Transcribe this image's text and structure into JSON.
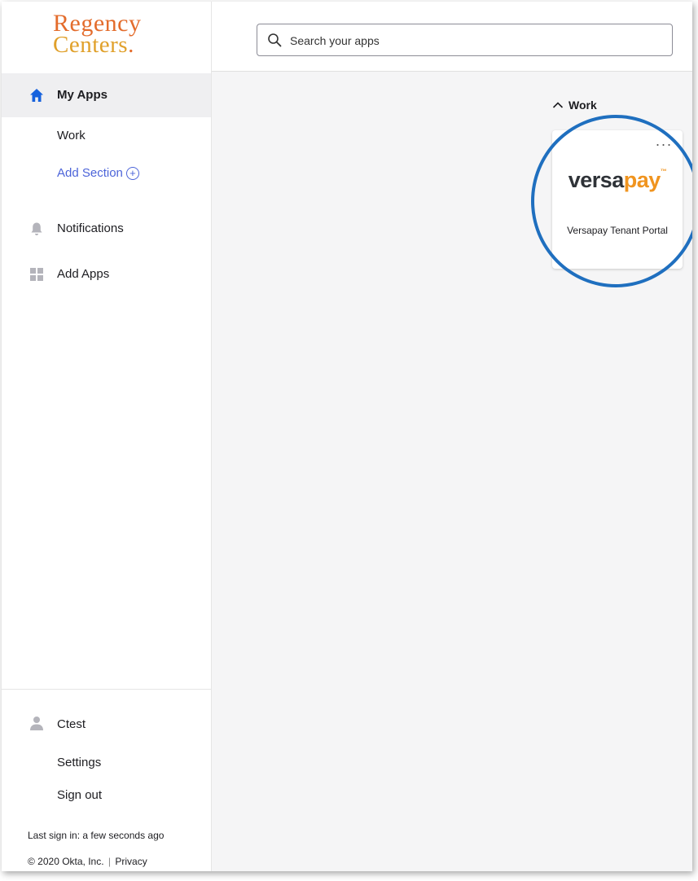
{
  "brand": {
    "line1": "Regency",
    "line2": "Centers",
    "line2_dot": "."
  },
  "sidebar": {
    "my_apps": "My Apps",
    "work": "Work",
    "add_section": "Add Section",
    "add_section_icon": "⊕",
    "notifications": "Notifications",
    "add_apps": "Add Apps"
  },
  "footer": {
    "user": "Ctest",
    "settings": "Settings",
    "sign_out": "Sign out",
    "last_sign_in": "Last sign in: a few seconds ago",
    "copyright": "© 2020 Okta, Inc.",
    "separator": "|",
    "privacy": "Privacy"
  },
  "search": {
    "placeholder": "Search your apps"
  },
  "section": {
    "title": "Work"
  },
  "app_tile": {
    "logo_part1": "versa",
    "logo_part2": "pay",
    "logo_tm": "™",
    "name": "Versapay Tenant Portal",
    "more": "..."
  },
  "colors": {
    "brand_orange": "#e36c2c",
    "brand_gold": "#e0a02a",
    "link_blue": "#4c64d9",
    "home_icon_blue": "#1662dd",
    "highlight_circle": "#1f6fbf",
    "versapay_orange": "#f0941f"
  },
  "icons": {
    "home": "home-icon",
    "bell": "bell-icon",
    "grid": "grid-icon",
    "user": "user-icon",
    "search": "search-icon",
    "chevron": "chevron-up-icon",
    "more": "more-icon"
  }
}
